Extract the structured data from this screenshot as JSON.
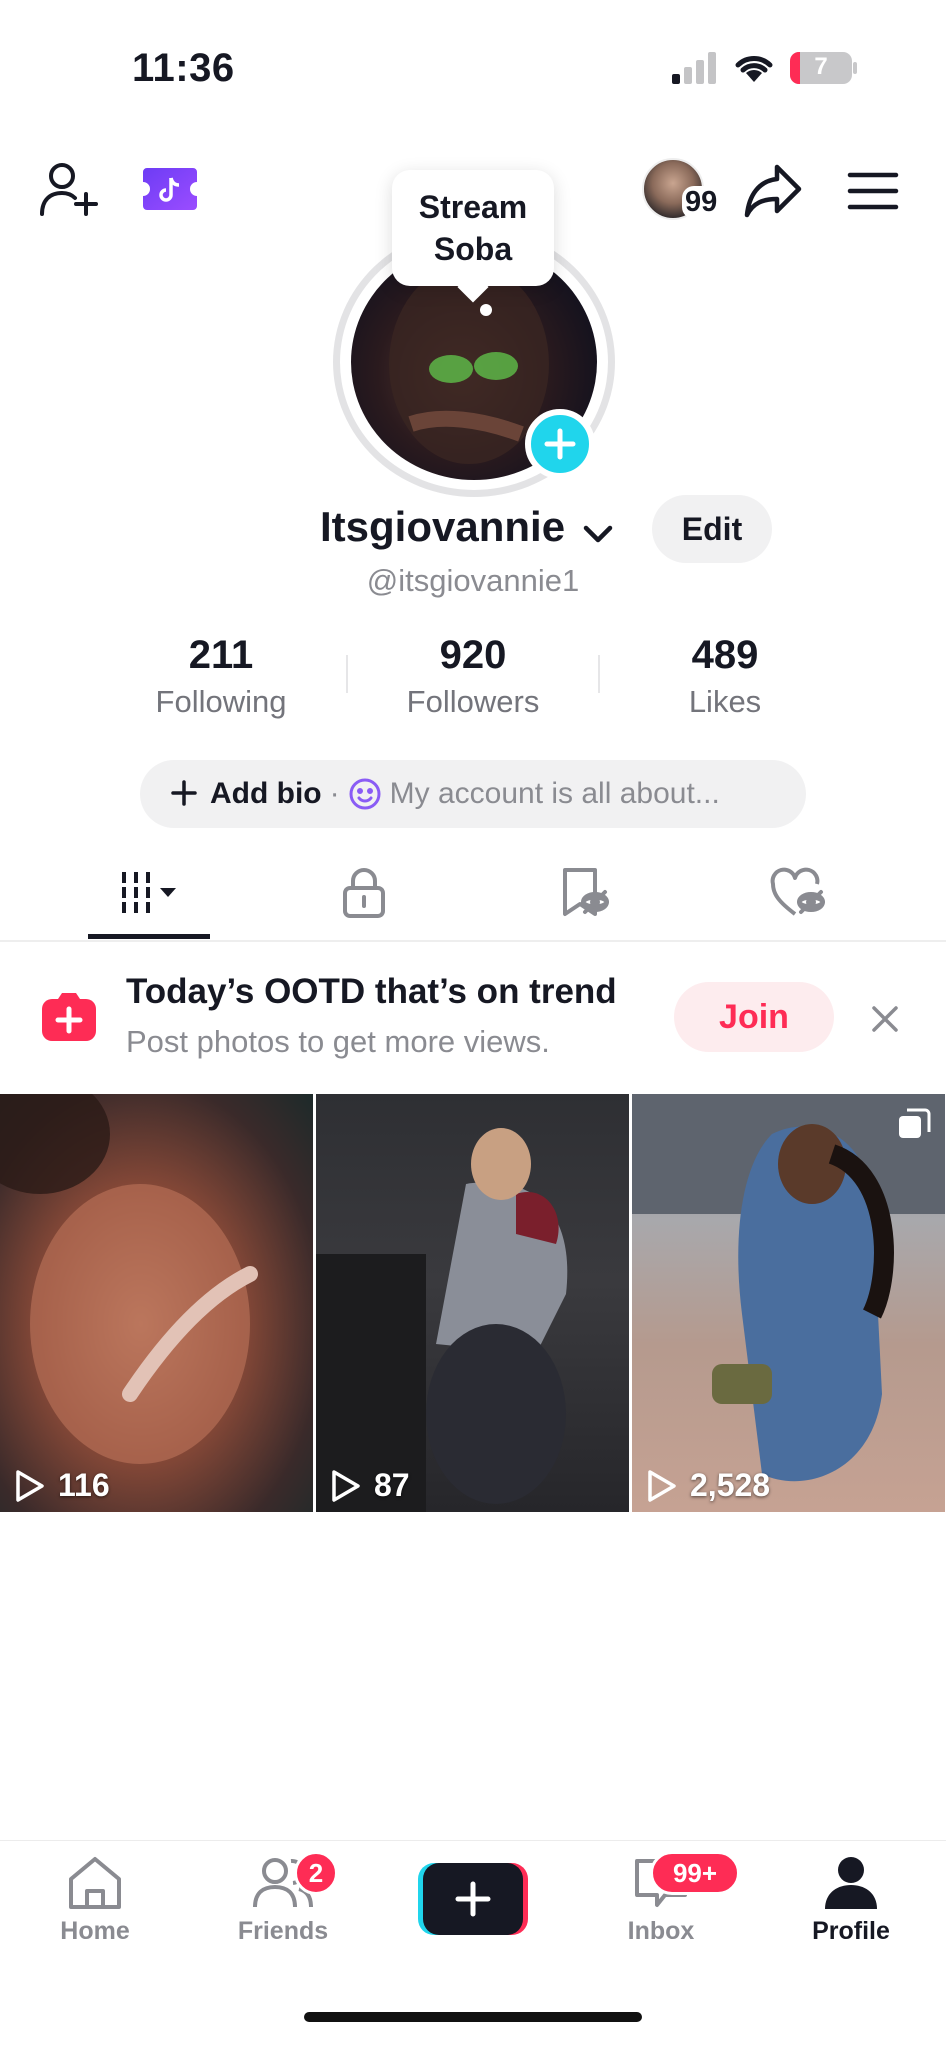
{
  "status_bar": {
    "time": "11:36",
    "battery": "7"
  },
  "top_bar": {
    "follower_badge": "99"
  },
  "avatar_tooltip": {
    "line1": "Stream",
    "line2": "Soba"
  },
  "profile": {
    "display_name": "Itsgiovannie",
    "edit_label": "Edit",
    "handle": "@itsgiovannie1",
    "stats": [
      {
        "value": "211",
        "label": "Following"
      },
      {
        "value": "920",
        "label": "Followers"
      },
      {
        "value": "489",
        "label": "Likes"
      }
    ],
    "bio": {
      "add_label": "Add bio",
      "dot": "·",
      "placeholder": "My account is all about..."
    }
  },
  "tabs": [
    {
      "icon": "grid-icon",
      "active": true
    },
    {
      "icon": "lock-icon",
      "active": false
    },
    {
      "icon": "bookmark-icon",
      "active": false
    },
    {
      "icon": "liked-heart-icon",
      "active": false
    }
  ],
  "promo": {
    "title": "Today’s OOTD that’s on trend",
    "subtitle": "Post photos to get more views.",
    "join_label": "Join"
  },
  "videos": [
    {
      "views": "116"
    },
    {
      "views": "87"
    },
    {
      "views": "2,528"
    }
  ],
  "bottom_nav": {
    "home": "Home",
    "friends": "Friends",
    "friends_badge": "2",
    "inbox": "Inbox",
    "inbox_badge": "99+",
    "profile": "Profile"
  },
  "colors": {
    "accent_red": "#fe2c55",
    "accent_cyan": "#20d5ec",
    "text": "#161823",
    "muted": "#8a8b91"
  }
}
